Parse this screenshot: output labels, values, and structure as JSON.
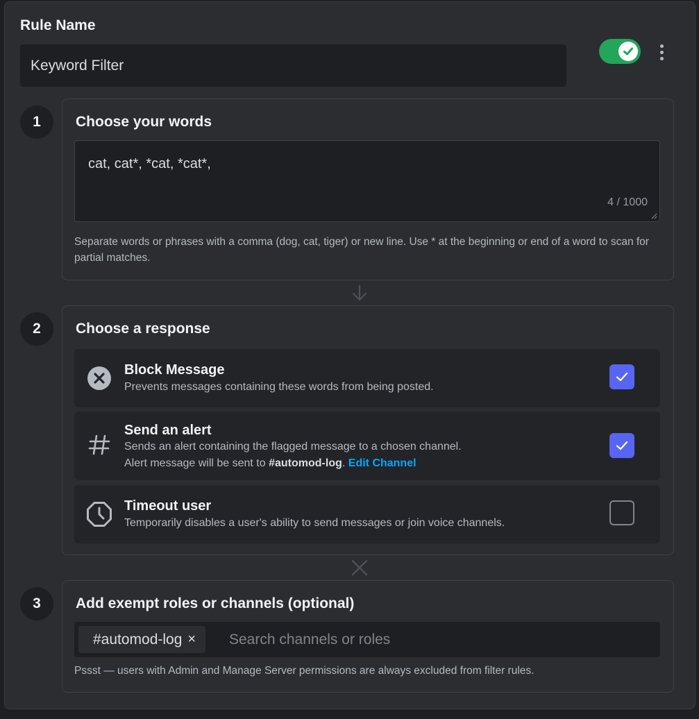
{
  "rule": {
    "label": "Rule Name",
    "name_value": "Keyword Filter",
    "enabled": true
  },
  "step1": {
    "number": "1",
    "title": "Choose your words",
    "words_value": "cat, cat*, *cat, *cat*,",
    "counter": "4 / 1000",
    "hint": "Separate words or phrases with a comma (dog, cat, tiger) or new line. Use * at the beginning or end of a word to scan for partial matches."
  },
  "step2": {
    "number": "2",
    "title": "Choose a response",
    "options": [
      {
        "title": "Block Message",
        "desc": "Prevents messages containing these words from being posted.",
        "icon": "block-x-circle-icon",
        "checked": true
      },
      {
        "title": "Send an alert",
        "desc": "Sends an alert containing the flagged message to a chosen channel.",
        "desc2_prefix": "Alert message will be sent to ",
        "desc2_channel": "#automod-log",
        "desc2_sep": ".",
        "edit_link": "Edit Channel",
        "icon": "hashtag-icon",
        "checked": true
      },
      {
        "title": "Timeout user",
        "desc": "Temporarily disables a user's ability to send messages or join voice channels.",
        "icon": "clock-octagon-icon",
        "checked": false
      }
    ]
  },
  "step3": {
    "number": "3",
    "title": "Add exempt roles or channels (optional)",
    "chip_label": "#automod-log",
    "chip_remove": "×",
    "search_placeholder": "Search channels or roles",
    "hint": "Pssst — users with Admin and Manage Server permissions are always excluded from filter rules."
  },
  "colors": {
    "accent": "#5865f2",
    "toggle_on": "#23a55a",
    "link": "#00a8fc",
    "panel_bg": "#2b2d31",
    "input_bg": "#1e1f22"
  }
}
